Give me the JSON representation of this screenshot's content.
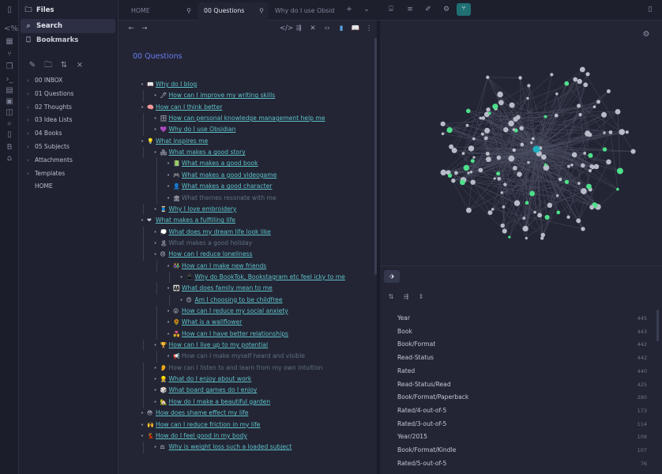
{
  "sidebar": {
    "files_label": "Files",
    "search_label": "Search",
    "bookmarks_label": "Bookmarks",
    "tree": [
      {
        "label": "00 INBOX",
        "folder": true
      },
      {
        "label": "01 Questions",
        "folder": true
      },
      {
        "label": "02 Thoughts",
        "folder": true
      },
      {
        "label": "03 Idea Lists",
        "folder": true
      },
      {
        "label": "04 Books",
        "folder": true
      },
      {
        "label": "05 Subjects",
        "folder": true
      },
      {
        "label": "Attachments",
        "folder": true
      },
      {
        "label": "Templates",
        "folder": true
      },
      {
        "label": "HOME",
        "folder": false
      }
    ]
  },
  "tabs": [
    {
      "label": "HOME",
      "active": false
    },
    {
      "label": "00 Questions",
      "active": true
    },
    {
      "label": "Why do I use Obsidi...",
      "active": false
    }
  ],
  "editor": {
    "title": "00 Questions",
    "items": [
      {
        "level": 0,
        "emoji": "📖",
        "text": "Why do I blog",
        "dim": false
      },
      {
        "level": 1,
        "emoji": "🖊",
        "text": "How can I improve my writing skills",
        "dim": false
      },
      {
        "level": 0,
        "emoji": "🧠",
        "text": "How can I think better",
        "dim": false
      },
      {
        "level": 1,
        "emoji": "🗄",
        "text": "How can personal knowledge management help me",
        "dim": false
      },
      {
        "level": 1,
        "emoji": "💜",
        "text": "Why do I use Obsidian",
        "dim": false
      },
      {
        "level": 0,
        "emoji": "💡",
        "text": "What inspires me",
        "dim": false
      },
      {
        "level": 1,
        "emoji": "🏘",
        "text": "What makes a good story",
        "dim": false
      },
      {
        "level": 2,
        "emoji": "📗",
        "text": "What makes a good book",
        "dim": false
      },
      {
        "level": 2,
        "emoji": "🎮",
        "text": "What makes a good videogame",
        "dim": false
      },
      {
        "level": 2,
        "emoji": "👤",
        "text": "What makes a good character",
        "dim": false
      },
      {
        "level": 2,
        "emoji": "🏛",
        "text": "What themes resonate with me",
        "dim": true
      },
      {
        "level": 1,
        "emoji": "🧵",
        "text": "Why I love embroidery",
        "dim": false
      },
      {
        "level": 0,
        "emoji": "❤",
        "text": "What makes a fulfilling life",
        "dim": false
      },
      {
        "level": 1,
        "emoji": "💭",
        "text": "What does my dream life look like",
        "dim": false
      },
      {
        "level": 1,
        "emoji": "🏝",
        "text": "What makes a good holiday",
        "dim": true
      },
      {
        "level": 1,
        "emoji": "😞",
        "text": "How can I reduce loneliness",
        "dim": false
      },
      {
        "level": 2,
        "emoji": "👫",
        "text": "How can I make new friends",
        "dim": false
      },
      {
        "level": 3,
        "emoji": "📱",
        "text": "Why do BookTok, Bookstagram etc feel icky to me",
        "dim": false
      },
      {
        "level": 2,
        "emoji": "👨‍👩‍👧",
        "text": "What does family mean to me",
        "dim": false
      },
      {
        "level": 3,
        "emoji": "😊",
        "text": "Am I choosing to be childfree",
        "dim": false
      },
      {
        "level": 2,
        "emoji": "😮",
        "text": "How can I reduce my social anxiety",
        "dim": false
      },
      {
        "level": 2,
        "emoji": "🌻",
        "text": "What is a wallflower",
        "dim": false
      },
      {
        "level": 2,
        "emoji": "💑",
        "text": "How can I have better relationships",
        "dim": false
      },
      {
        "level": 1,
        "emoji": "🏆",
        "text": "How can I live up to my potential",
        "dim": false
      },
      {
        "level": 2,
        "emoji": "📢",
        "text": "How can I make myself heard and visible",
        "dim": true
      },
      {
        "level": 1,
        "emoji": "👂",
        "text": "How can I listen to and learn from my own intuition",
        "dim": true
      },
      {
        "level": 1,
        "emoji": "👷",
        "text": "What do I enjoy about work",
        "dim": false
      },
      {
        "level": 1,
        "emoji": "🎲",
        "text": "What board games do I enjoy",
        "dim": false
      },
      {
        "level": 1,
        "emoji": "🏡",
        "text": "How do I make a beautiful garden",
        "dim": false
      },
      {
        "level": 0,
        "emoji": "😳",
        "text": "How does shame effect my life",
        "dim": false
      },
      {
        "level": 0,
        "emoji": "🙌",
        "text": "How can I reduce friction in my life",
        "dim": false
      },
      {
        "level": 0,
        "emoji": "💃",
        "text": "How do I feel good in my body",
        "dim": false
      },
      {
        "level": 1,
        "emoji": "⚖",
        "text": "Why is weight loss such a loaded subject",
        "dim": false
      }
    ]
  },
  "tags": [
    {
      "name": "Year",
      "count": "445"
    },
    {
      "name": "Book",
      "count": "443"
    },
    {
      "name": "Book/Format",
      "count": "442"
    },
    {
      "name": "Read-Status",
      "count": "442"
    },
    {
      "name": "Rated",
      "count": "440"
    },
    {
      "name": "Read-Status/Read",
      "count": "425"
    },
    {
      "name": "Book/Format/Paperback",
      "count": "280"
    },
    {
      "name": "Rated/4-out-of-5",
      "count": "173"
    },
    {
      "name": "Rated/3-out-of-5",
      "count": "114"
    },
    {
      "name": "Year/2015",
      "count": "108"
    },
    {
      "name": "Book/Format/Kindle",
      "count": "107"
    },
    {
      "name": "Rated/5-out-of-5",
      "count": "76"
    }
  ],
  "colors": {
    "accent": "#1f6f73",
    "link": "#5ec2c9",
    "title": "#6a7cf0",
    "graph_node": "#b8bcc8",
    "graph_node_tag": "#4ee08a",
    "graph_node_active": "#1fb0c0"
  }
}
